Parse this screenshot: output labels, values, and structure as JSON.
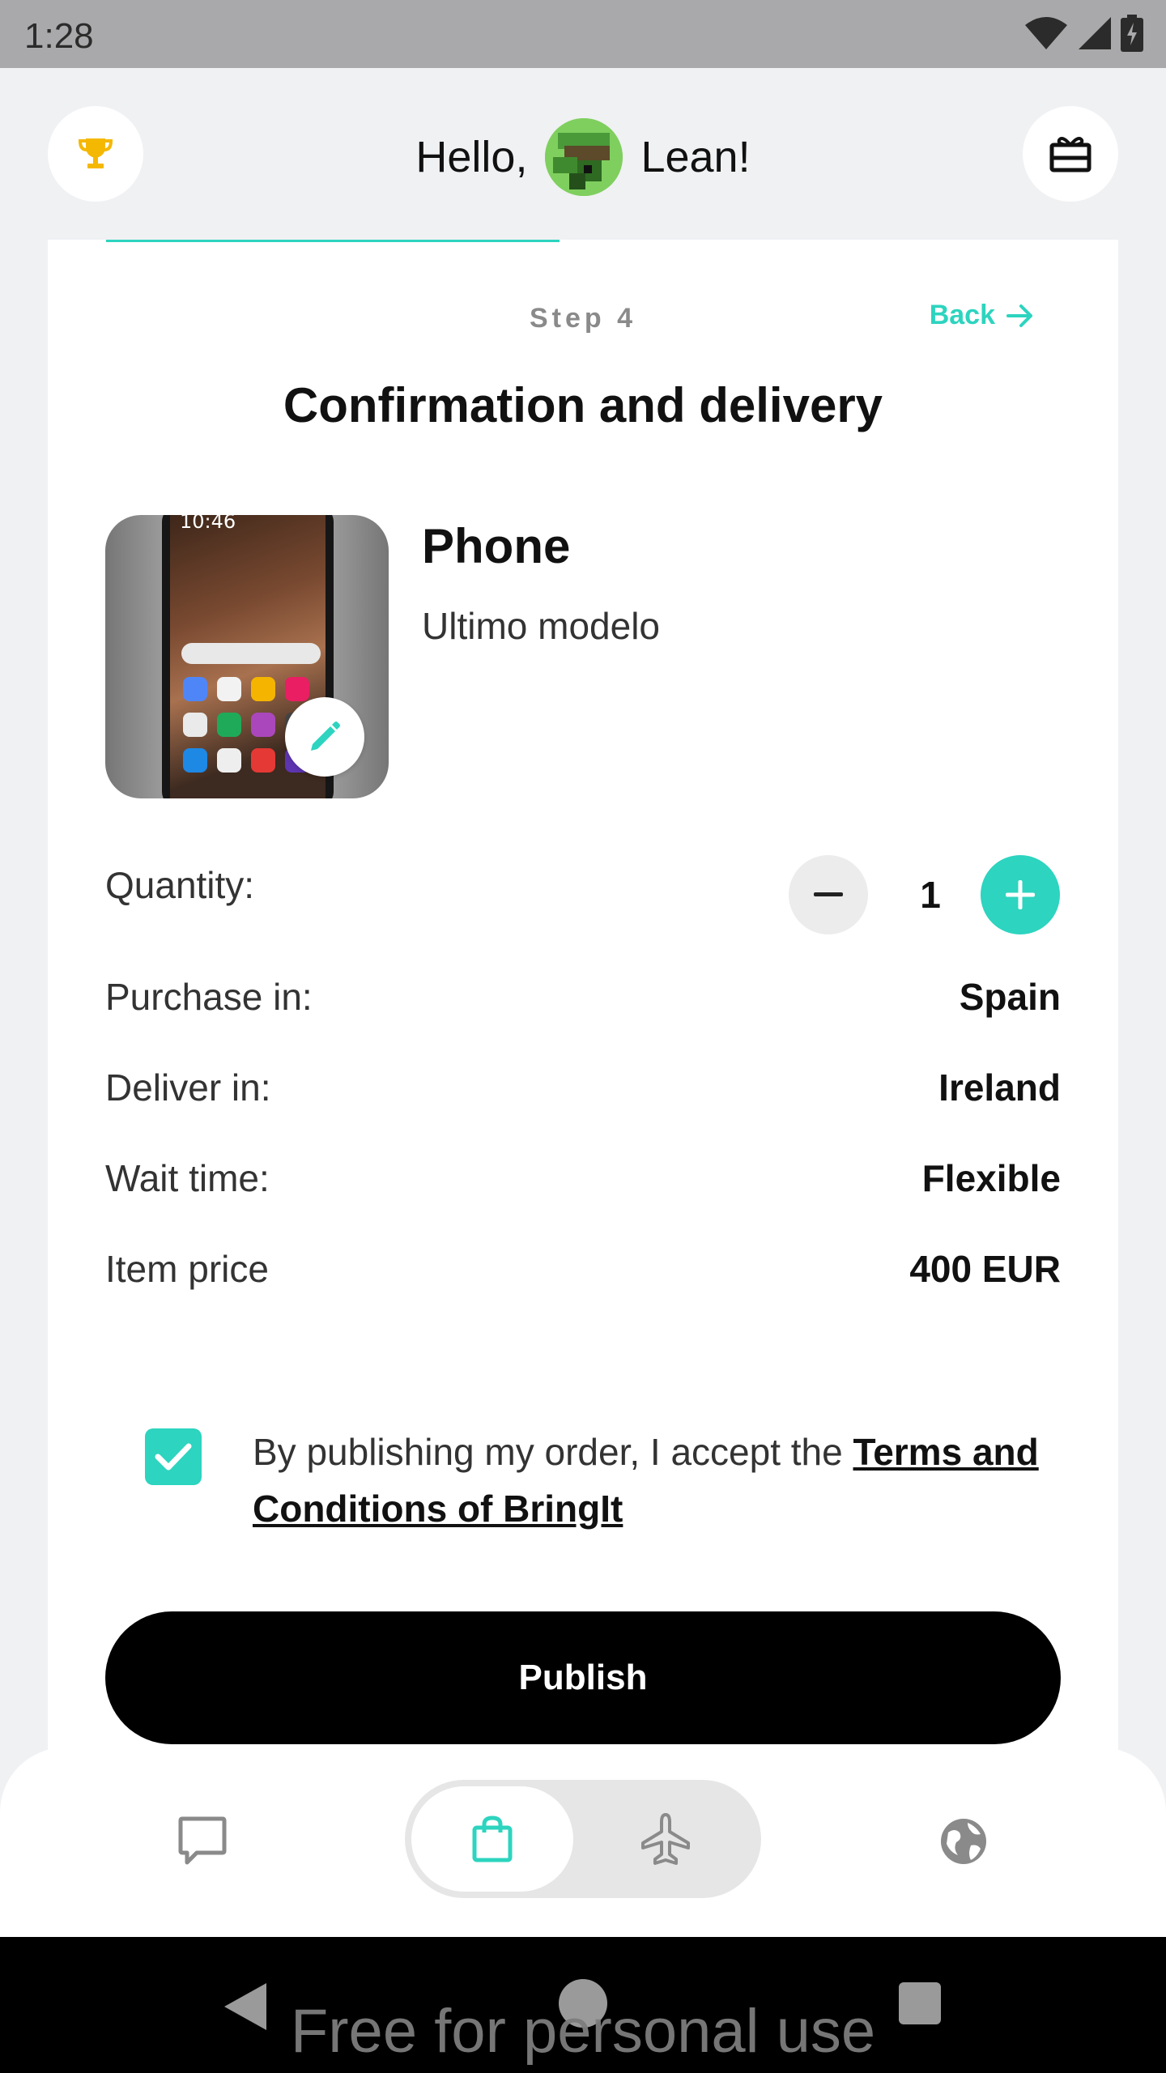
{
  "status": {
    "time": "1:28"
  },
  "header": {
    "greeting_prefix": "Hello,",
    "user_name": "Lean!"
  },
  "wizard": {
    "step_label": "Step 4",
    "back_label": "Back",
    "title": "Confirmation and delivery"
  },
  "product": {
    "name": "Phone",
    "description": "Ultimo modelo",
    "image_time": "10:46"
  },
  "details": {
    "quantity_label": "Quantity:",
    "quantity_value": "1",
    "purchase_label": "Purchase in:",
    "purchase_value": "Spain",
    "deliver_label": "Deliver in:",
    "deliver_value": "Ireland",
    "wait_label": "Wait time:",
    "wait_value": "Flexible",
    "price_label": "Item price",
    "price_value": "400 EUR"
  },
  "terms": {
    "checked": true,
    "text": "By publishing my order, I accept the ",
    "link_text": "Terms and Conditions of BringIt"
  },
  "actions": {
    "publish_label": "Publish"
  },
  "bottom_nav": {
    "items": [
      "chat-icon",
      "shopping-bag-icon",
      "airplane-icon",
      "globe-icon"
    ],
    "active": "shopping-bag-icon"
  },
  "watermark": "Free for personal use",
  "colors": {
    "accent": "#2dd4bf",
    "trophy": "#f5b800",
    "primary_button": "#000000"
  }
}
